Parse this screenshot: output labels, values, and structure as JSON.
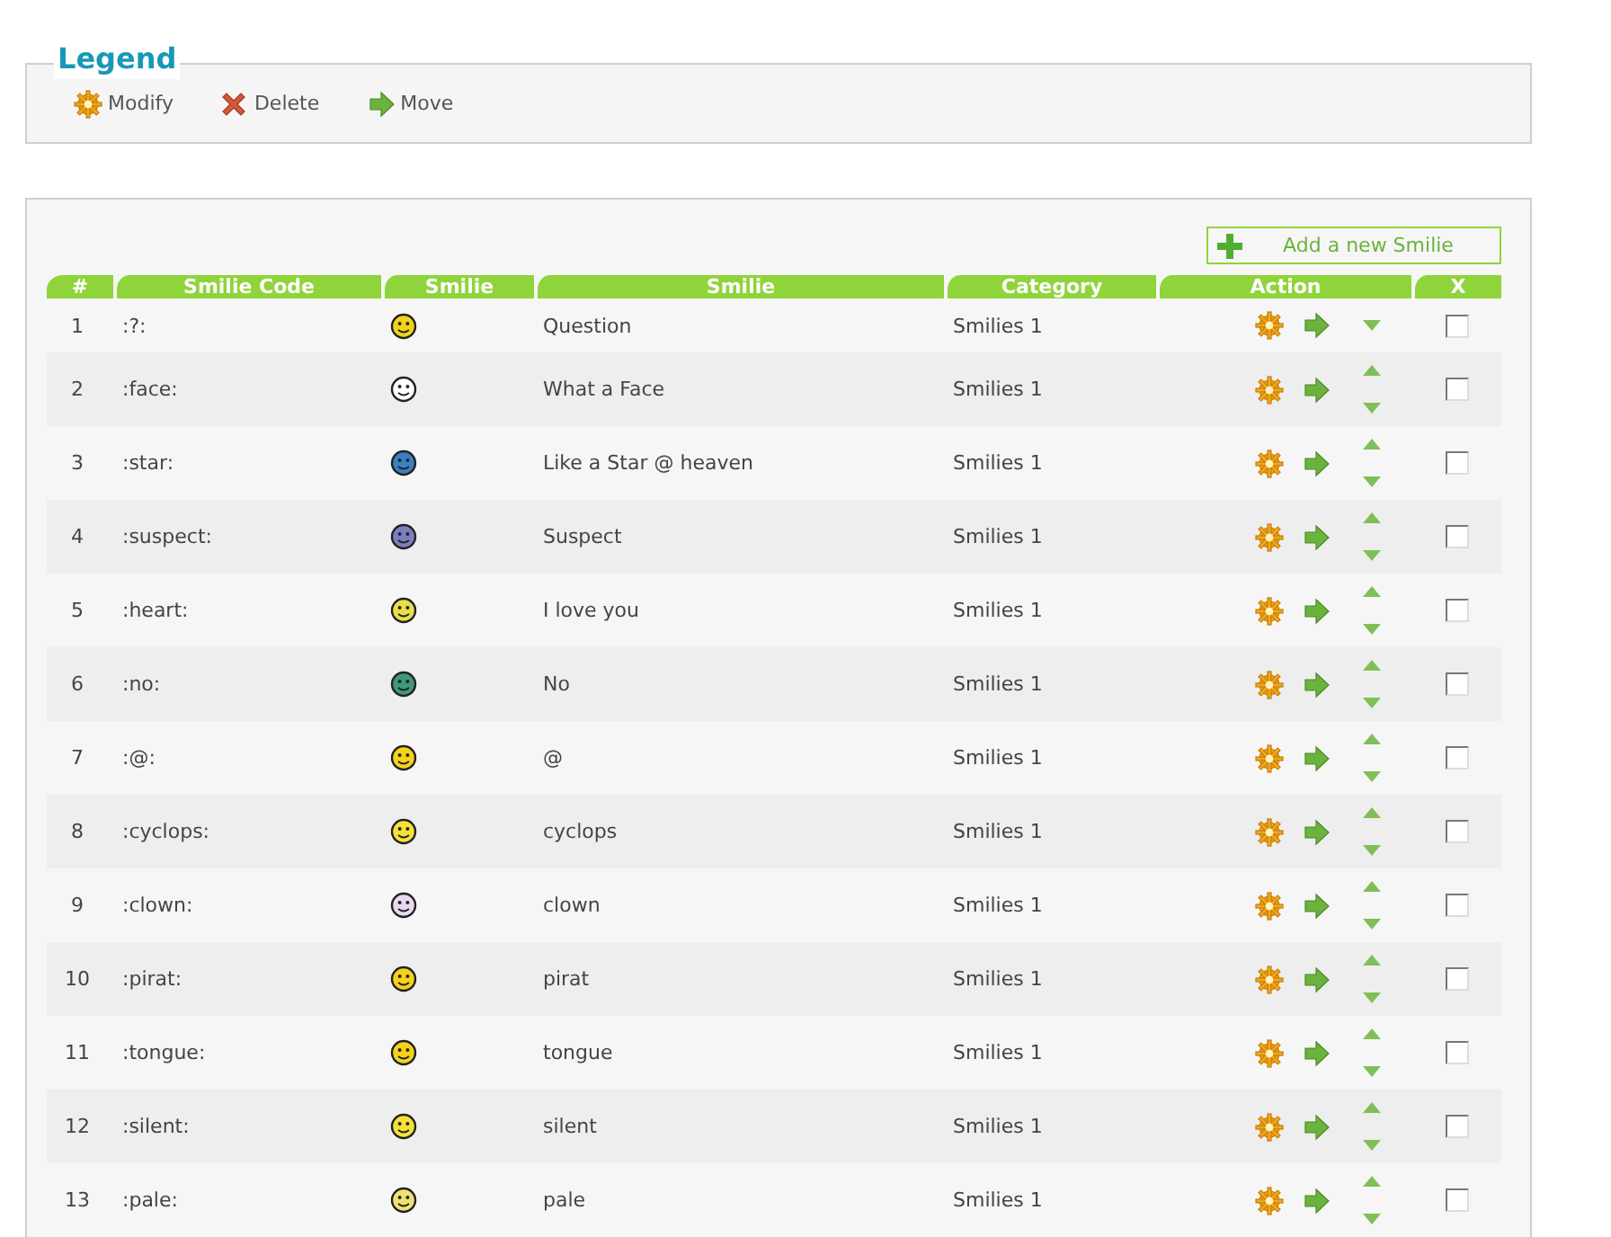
{
  "legend": {
    "title": "Legend",
    "items": [
      {
        "kind": "modify",
        "label": "Modify"
      },
      {
        "kind": "delete",
        "label": "Delete"
      },
      {
        "kind": "move",
        "label": "Move"
      }
    ]
  },
  "add_button": {
    "label": "Add a new Smilie"
  },
  "table": {
    "columns": [
      "#",
      "Smilie Code",
      "Smilie",
      "Smilie",
      "Category",
      "Action",
      "X"
    ],
    "rows": [
      {
        "number": "1",
        "code": ":?:",
        "color": "#f2d21b",
        "name": "Question",
        "category": "Smilies 1",
        "can_move_up": false,
        "can_move_down": true,
        "checked": false
      },
      {
        "number": "2",
        "code": ":face:",
        "color": "#ffffff",
        "name": "What a Face",
        "category": "Smilies 1",
        "can_move_up": true,
        "can_move_down": true,
        "checked": false
      },
      {
        "number": "3",
        "code": ":star:",
        "color": "#3b7fc4",
        "name": "Like a Star @ heaven",
        "category": "Smilies 1",
        "can_move_up": true,
        "can_move_down": true,
        "checked": false
      },
      {
        "number": "4",
        "code": ":suspect:",
        "color": "#7a7fc0",
        "name": "Suspect",
        "category": "Smilies 1",
        "can_move_up": true,
        "can_move_down": true,
        "checked": false
      },
      {
        "number": "5",
        "code": ":heart:",
        "color": "#e6e04a",
        "name": "I love you",
        "category": "Smilies 1",
        "can_move_up": true,
        "can_move_down": true,
        "checked": false
      },
      {
        "number": "6",
        "code": ":no:",
        "color": "#3e9a78",
        "name": "No",
        "category": "Smilies 1",
        "can_move_up": true,
        "can_move_down": true,
        "checked": false
      },
      {
        "number": "7",
        "code": ":@:",
        "color": "#f4d21a",
        "name": "@",
        "category": "Smilies 1",
        "can_move_up": true,
        "can_move_down": true,
        "checked": false
      },
      {
        "number": "8",
        "code": ":cyclops:",
        "color": "#f6e03a",
        "name": "cyclops",
        "category": "Smilies 1",
        "can_move_up": true,
        "can_move_down": true,
        "checked": false
      },
      {
        "number": "9",
        "code": ":clown:",
        "color": "#e8d8f0",
        "name": "clown",
        "category": "Smilies 1",
        "can_move_up": true,
        "can_move_down": true,
        "checked": false
      },
      {
        "number": "10",
        "code": ":pirat:",
        "color": "#f4d21a",
        "name": "pirat",
        "category": "Smilies 1",
        "can_move_up": true,
        "can_move_down": true,
        "checked": false
      },
      {
        "number": "11",
        "code": ":tongue:",
        "color": "#f4d21a",
        "name": "tongue",
        "category": "Smilies 1",
        "can_move_up": true,
        "can_move_down": true,
        "checked": false
      },
      {
        "number": "12",
        "code": ":silent:",
        "color": "#f6e03a",
        "name": "silent",
        "category": "Smilies 1",
        "can_move_up": true,
        "can_move_down": true,
        "checked": false
      },
      {
        "number": "13",
        "code": ":pale:",
        "color": "#f2e070",
        "name": "pale",
        "category": "Smilies 1",
        "can_move_up": true,
        "can_move_down": true,
        "checked": false
      }
    ]
  }
}
